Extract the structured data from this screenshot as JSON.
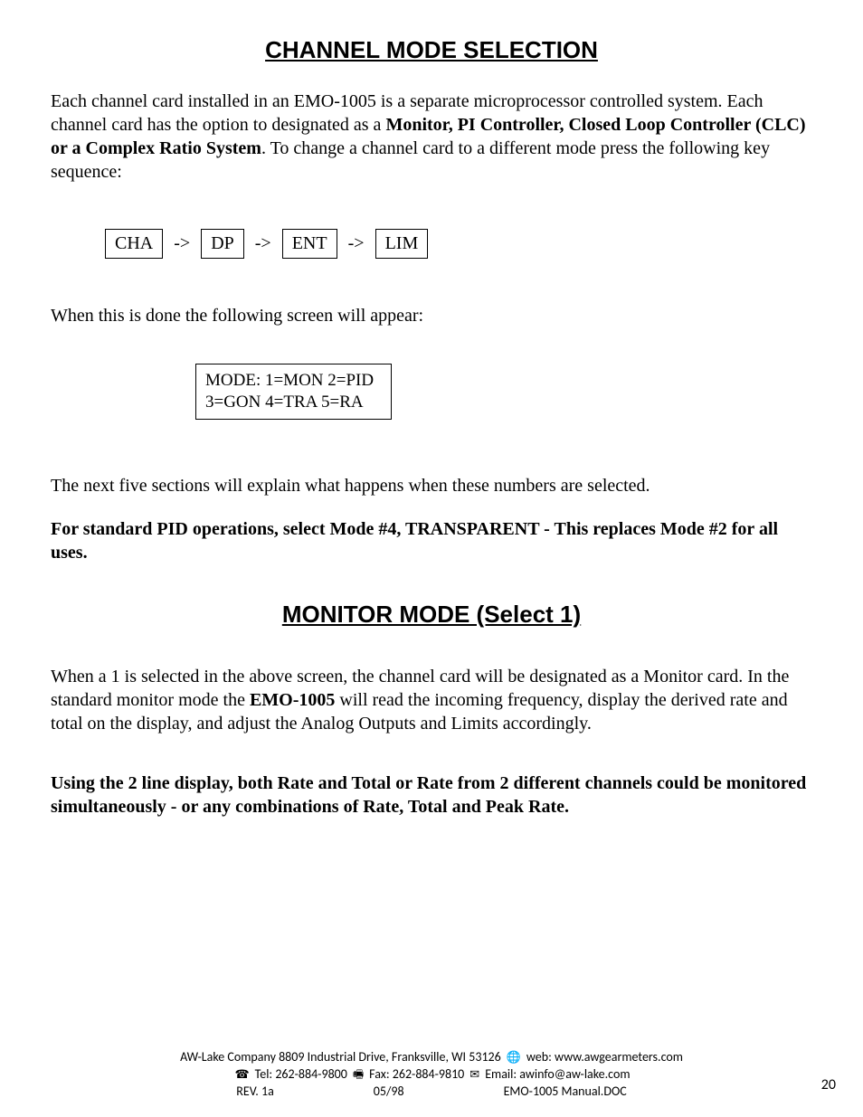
{
  "heading1": "CHANNEL MODE SELECTION",
  "para1_a": "Each channel card installed in an EMO-1005 is a separate microprocessor controlled system. Each channel card has the option to designated as a ",
  "para1_b": "Monitor, PI Controller, Closed Loop Controller (CLC) or a Complex Ratio System",
  "para1_c": ". To change a channel card to a different mode press the following key sequence:",
  "keys": {
    "k1": "CHA",
    "k2": "DP",
    "k3": "ENT",
    "k4": "LIM",
    "arrow": "->"
  },
  "para2": "When this is done the following screen will appear:",
  "screen_line1": "MODE: 1=MON 2=PID",
  "screen_line2": "3=GON 4=TRA 5=RA",
  "para3": "The next five sections will explain what happens when these numbers are selected.",
  "para4": "For standard PID operations, select Mode #4, TRANSPARENT - This replaces Mode #2  for all uses.",
  "heading2": "MONITOR MODE  (Select 1)",
  "para5_a": "When a 1 is selected in the above screen, the channel card will be designated as a Monitor card. In the standard monitor mode the ",
  "para5_b": "EMO-1005",
  "para5_c": " will read the incoming frequency, display the derived rate and total on the display, and adjust the Analog Outputs and Limits accordingly.",
  "para6": "Using the 2 line display, both Rate and Total or Rate from 2 different channels could be monitored simultaneously  - or any combinations of Rate, Total and Peak Rate.",
  "footer": {
    "addr": "AW-Lake Company 8809 Industrial Drive, Franksville, WI 53126",
    "web_label": " web: www.awgearmeters.com",
    "tel_label": " Tel:  262-884-9800 ",
    "fax_label": " Fax:  262-884-9810 ",
    "email_label": " Email: awinfo@aw-lake.com",
    "rev": "REV. 1a",
    "date": "05/98",
    "doc": "EMO-1005 Manual.DOC"
  },
  "page_number": "20"
}
